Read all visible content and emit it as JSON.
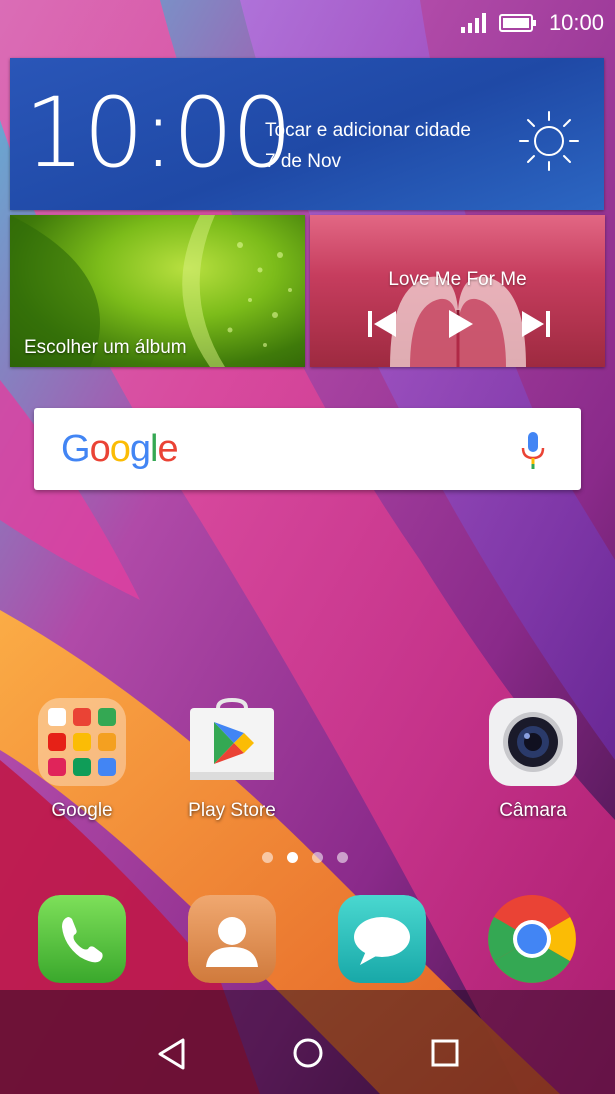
{
  "status_bar": {
    "time": "10:00",
    "icons": [
      "signal-icon",
      "battery-icon"
    ]
  },
  "weather_widget": {
    "time": "10:00",
    "city_prompt": "Tocar e adicionar cidade",
    "date": "7 de Nov",
    "icon": "sun-icon"
  },
  "photo_widget": {
    "label": "Escolher um álbum"
  },
  "music_widget": {
    "song": "Love Me For Me",
    "controls": [
      "previous-icon",
      "play-icon",
      "next-icon"
    ]
  },
  "search_widget": {
    "logo": "Google",
    "icon": "mic-icon"
  },
  "home_apps": [
    {
      "label": "Google"
    },
    {
      "label": "Play Store"
    },
    {
      "label": "Câmara"
    }
  ],
  "page_indicator": {
    "pages": 4,
    "current": 2
  },
  "dock": [
    "phone-icon",
    "contacts-icon",
    "messages-icon",
    "chrome-icon"
  ],
  "nav_bar": [
    "back-icon",
    "home-icon",
    "recents-icon"
  ],
  "colors": {
    "google_blue": "#4285F4",
    "google_red": "#EA4335",
    "google_yellow": "#FBBC05",
    "google_green": "#34A853"
  }
}
